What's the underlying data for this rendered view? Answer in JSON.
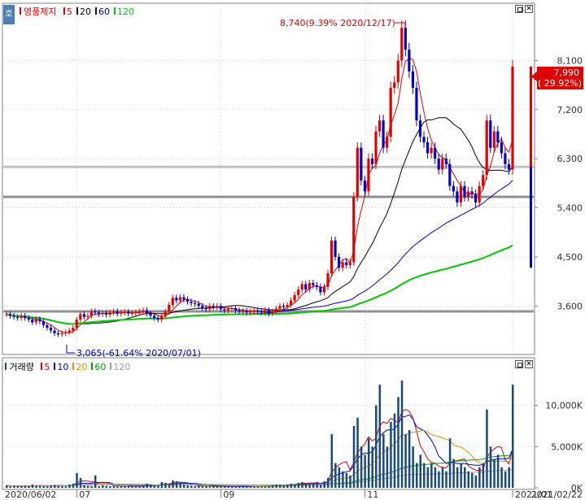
{
  "price_panel": {
    "corner_icon": "호",
    "stock_name": "영풍제지",
    "ma_labels": [
      {
        "label": "5",
        "color": "#e00000"
      },
      {
        "label": "20",
        "color": "#000000"
      },
      {
        "label": "60",
        "color": "#0000c8"
      },
      {
        "label": "120",
        "color": "#00c800"
      }
    ],
    "high_annotation": "8,740(9.39% 2020/12/17)",
    "low_annotation": "3,065(-61.64% 2020/07/01)",
    "current_price": "7,990",
    "current_change": "( 29.92%)"
  },
  "volume_panel": {
    "title": "거래량",
    "ma_labels": [
      {
        "label": "5",
        "color": "#e00000"
      },
      {
        "label": "10",
        "color": "#0000c8"
      },
      {
        "label": "20",
        "color": "#e09000"
      },
      {
        "label": "60",
        "color": "#00a000"
      },
      {
        "label": "120",
        "color": "#a0a0a0"
      }
    ]
  },
  "x_axis": {
    "labels": [
      "2020/06/02",
      "07",
      "09",
      "11",
      "2021/01"
    ],
    "end_date": "2021/02/22"
  },
  "colors": {
    "up": "#e00000",
    "down": "#0000c8"
  },
  "chart_data": [
    {
      "type": "candlestick",
      "title": "영풍제지",
      "y_ticks": [
        3600,
        4500,
        5400,
        6300,
        7200,
        8100
      ],
      "y_tick_labels": [
        "3,600",
        "4,500",
        "5,400",
        "6,300",
        "7,200",
        "8,100"
      ],
      "ylim": [
        2800,
        9000
      ],
      "horizontal_lines": [
        6150,
        5600,
        3500
      ],
      "annotations": [
        {
          "text": "8,740(9.39% 2020/12/17)",
          "value": 8740,
          "date": "2020/12/17"
        },
        {
          "text": "3,065(-61.64% 2020/07/01)",
          "value": 3065,
          "date": "2020/07/01"
        }
      ],
      "last_close": 7990,
      "last_change_pct": 29.92,
      "close_series": [
        3450,
        3420,
        3400,
        3380,
        3420,
        3380,
        3350,
        3300,
        3360,
        3320,
        3250,
        3200,
        3150,
        3100,
        3080,
        3100,
        3120,
        3150,
        3200,
        3350,
        3450,
        3400,
        3420,
        3500,
        3480,
        3450,
        3470,
        3440,
        3480,
        3500,
        3460,
        3480,
        3490,
        3460,
        3470,
        3480,
        3500,
        3520,
        3460,
        3420,
        3380,
        3350,
        3420,
        3500,
        3620,
        3750,
        3700,
        3760,
        3720,
        3680,
        3650,
        3640,
        3600,
        3560,
        3540,
        3600,
        3580,
        3600,
        3540,
        3520,
        3550,
        3560,
        3520,
        3500,
        3510,
        3480,
        3500,
        3520,
        3500,
        3480,
        3520,
        3460,
        3500,
        3550,
        3600,
        3580,
        3620,
        3700,
        3800,
        3900,
        4000,
        3900,
        4020,
        3980,
        3950,
        3850,
        3950,
        4200,
        4800,
        4500,
        4300,
        4400,
        4350,
        4400,
        5600,
        6500,
        5900,
        5700,
        6300,
        6200,
        6800,
        7000,
        6500,
        6700,
        7600,
        7700,
        8100,
        8700,
        8300,
        7900,
        7600,
        7000,
        6700,
        6600,
        6400,
        6500,
        6300,
        6100,
        6300,
        6200,
        5800,
        5700,
        5500,
        5800,
        5600,
        5700,
        5650,
        5500,
        5800,
        6000,
        7000,
        6500,
        6800,
        6600,
        6400,
        6200,
        6100,
        7990
      ]
    },
    {
      "type": "bar",
      "title": "거래량",
      "y_ticks": [
        0,
        5000,
        10000
      ],
      "y_tick_labels": [
        "0K",
        "5,000K",
        "10,000K"
      ],
      "ylim": [
        0,
        14000
      ],
      "unit": "K",
      "values": [
        300,
        200,
        250,
        200,
        180,
        220,
        200,
        400,
        300,
        250,
        200,
        180,
        300,
        350,
        250,
        200,
        180,
        400,
        500,
        1800,
        1200,
        300,
        250,
        200,
        1500,
        200,
        300,
        250,
        200,
        180,
        150,
        200,
        250,
        200,
        180,
        200,
        250,
        300,
        500,
        400,
        300,
        280,
        700,
        600,
        500,
        900,
        800,
        600,
        400,
        300,
        250,
        200,
        250,
        200,
        200,
        180,
        200,
        180,
        200,
        180,
        150,
        160,
        180,
        200,
        180,
        170,
        160,
        150,
        180,
        170,
        160,
        200,
        300,
        400,
        350,
        300,
        400,
        500,
        450,
        600,
        700,
        500,
        600,
        500,
        700,
        400,
        800,
        1200,
        6500,
        3000,
        2500,
        2000,
        1800,
        1500,
        7500,
        8500,
        5000,
        4000,
        6000,
        5000,
        10000,
        12500,
        6500,
        5000,
        8000,
        9000,
        11000,
        13000,
        6500,
        7000,
        5000,
        3000,
        4000,
        3000,
        2500,
        3000,
        2500,
        2000,
        2500,
        2000,
        6000,
        3500,
        2500,
        3000,
        2500,
        2000,
        1800,
        1500,
        2500,
        3000,
        9500,
        5000,
        3500,
        4000,
        2500,
        2000,
        2500,
        12500
      ]
    }
  ]
}
